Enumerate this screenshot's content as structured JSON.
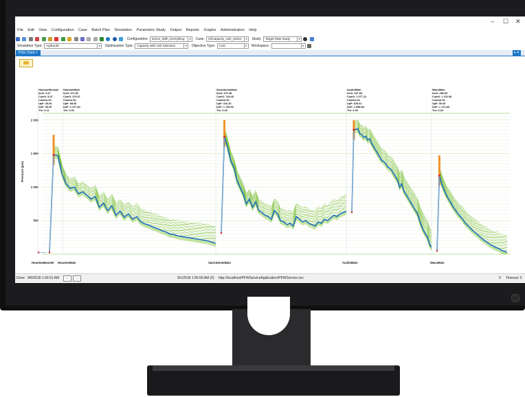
{
  "window": {
    "minimize": "–",
    "maximize": "☐",
    "close": "✕"
  },
  "menu": [
    "File",
    "Edit",
    "View",
    "Configuration",
    "Case",
    "Batch Plan",
    "Simulation",
    "Parametric Study",
    "Output",
    "Reports",
    "Graphs",
    "Administration",
    "Help"
  ],
  "toolbar": {
    "configuration_label": "Configuration:",
    "configuration_value": "Demo_With_Everything",
    "case_label": "Case:",
    "case_value": "(3)Capacity_Unit_Select",
    "study_label": "Study:",
    "study_value": "Target Rate Study"
  },
  "toolbar2": {
    "sim_type_label": "Simulation Type:",
    "sim_type_value": "Hydraulic",
    "opt_type_label": "Optimization Type:",
    "opt_type_value": "Capacity with Unit Selection",
    "obj_type_label": "Objective Type:",
    "obj_type_value": "Cost",
    "workspace_label": "Workspace:",
    "workspace_value": ""
  },
  "tabs": [
    {
      "label": "PSS Chart",
      "close": "×"
    }
  ],
  "tab_menu": "▾ ✕",
  "status": {
    "done_label": "Done",
    "done_time": "9/8/2018 1:00:01 AM",
    "sim_time": "9/1/2018 1:00:00 AM (0)",
    "url": "http://localhost/PFWServiceApplication/PFWService.svc",
    "zoom": "0",
    "timeout": "Timeout: 0"
  },
  "chart_data": {
    "type": "line",
    "ylabel": "Pressure (psi)",
    "ylim": [
      0,
      2100
    ],
    "yticks": [
      500,
      1000,
      1500,
      2000
    ],
    "ytick_labels": [
      "500",
      "1 000",
      "1 500",
      "2 000"
    ],
    "grid": true,
    "node_labels": [
      "HoustonBooster",
      "HoustonMain",
      "SanAntonioMain",
      "AustinMain",
      "WacoMain"
    ],
    "stations": [
      {
        "name": "HoustonBooster",
        "lines": [
          "HoustonBooster",
          "InsS: 5.47",
          "CumS: 5.47",
          "Combo:S1",
          "UpP: 25.00",
          "DnP: 50.00",
          "Thr: 0.11"
        ]
      },
      {
        "name": "HoustonMain",
        "lines": [
          "HoustonMain",
          "InsS: 371.50",
          "CumS: 376.97",
          "Combo:S1",
          "UpP: 58.00",
          "DnP: 1 477.84",
          "Thr: 0.00"
        ]
      },
      {
        "name": "SanAntonioMain",
        "lines": [
          "SanAntonioMain",
          "InsS: 372.48",
          "CumS: 749.45",
          "Combo:S1",
          "UpP: 316.20",
          "DnP: 1 749.00",
          "Thr: 0.00"
        ]
      },
      {
        "name": "AustinMain",
        "lines": [
          "AustinMain",
          "InsS: 327.68",
          "CumS: 1 077.13",
          "Combo:S1",
          "UpP: 625.61",
          "DnP: 1 855.88",
          "Thr: 0.00"
        ]
      },
      {
        "name": "WacoMain",
        "lines": [
          "WacoMain",
          "InsS: 298.95",
          "CumS: 1 376.08",
          "Combo:S1",
          "UpP: 50.00",
          "DnP: 1 172.88",
          "Thr: 0.00"
        ]
      }
    ],
    "x": [
      0,
      1,
      2,
      3,
      4,
      5,
      6,
      7,
      8,
      9,
      10,
      11,
      12,
      13,
      14,
      15,
      16,
      17,
      18,
      19,
      20,
      21,
      22,
      23,
      24,
      25,
      26,
      27,
      28,
      29,
      30,
      31,
      32,
      33,
      34,
      35,
      36,
      37,
      38,
      39,
      40
    ],
    "series": [
      {
        "values": [
          25,
          1480,
          1470,
          1200,
          1050,
          980,
          1000,
          900,
          930,
          880,
          820,
          860,
          700,
          760,
          650,
          720,
          580,
          640,
          550,
          600,
          520,
          560,
          480,
          450,
          430,
          400,
          380,
          350,
          330,
          300,
          290,
          270,
          260,
          250,
          240,
          230,
          220,
          210,
          200,
          180,
          160
        ]
      },
      {
        "values": [
          316,
          1749,
          1600,
          1400,
          1300,
          1100,
          1000,
          900,
          750,
          820,
          700,
          780,
          650,
          620,
          580,
          560,
          520,
          650,
          600,
          500,
          480,
          440,
          460,
          420,
          560,
          520,
          480,
          500,
          460,
          440,
          420,
          480,
          460,
          520,
          500,
          540,
          580,
          560,
          600,
          620,
          640
        ]
      },
      {
        "values": [
          625,
          1855,
          1860,
          1870,
          1800,
          1780,
          1740,
          1760,
          1700,
          1720,
          1650,
          1600,
          1550,
          1500,
          1450,
          1400,
          1380,
          1350,
          1300,
          1280,
          1250,
          1200,
          1150,
          1100,
          1000,
          1050,
          950,
          900,
          850,
          800,
          750,
          700,
          650,
          600,
          500,
          420,
          350,
          300,
          250,
          150,
          100
        ]
      },
      {
        "values": [
          50,
          1172,
          1050,
          960,
          880,
          820,
          760,
          700,
          650,
          600,
          560,
          520,
          470,
          430,
          400,
          360,
          330,
          300,
          270,
          240,
          210,
          190,
          160,
          140,
          120,
          100,
          90,
          70,
          50,
          40,
          30
        ]
      }
    ]
  }
}
